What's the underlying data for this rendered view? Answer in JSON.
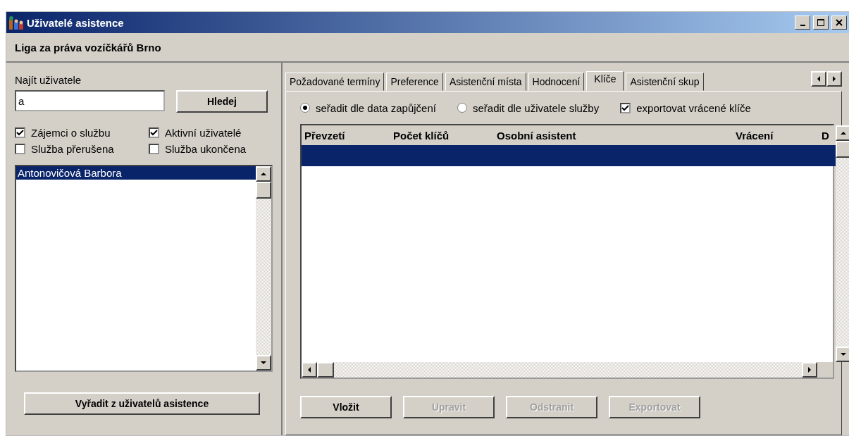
{
  "window": {
    "title": "Uživatelé asistence"
  },
  "organization": "Liga za práva vozíčkářů Brno",
  "search": {
    "label": "Najít uživatele",
    "value": "a",
    "button": "Hledej"
  },
  "filters": [
    {
      "label": "Zájemci o službu",
      "checked": true
    },
    {
      "label": "Aktivní uživatelé",
      "checked": true
    },
    {
      "label": "Služba přerušena",
      "checked": false
    },
    {
      "label": "Služba ukončena",
      "checked": false
    }
  ],
  "users": [
    {
      "name": "Antonovičová Barbora",
      "selected": true
    }
  ],
  "remove_button": "Vyřadit z uživatelů asistence",
  "tabs": [
    {
      "label": "Požadované termíny",
      "selected": false
    },
    {
      "label": "Preference",
      "selected": false
    },
    {
      "label": "Asistenční místa",
      "selected": false
    },
    {
      "label": "Hodnocení",
      "selected": false
    },
    {
      "label": "Klíče",
      "selected": true
    },
    {
      "label": "Asistenční skup",
      "selected": false
    }
  ],
  "sort_options": [
    {
      "label": "seřadit dle data zapůjčení",
      "selected": true
    },
    {
      "label": "seřadit dle uživatele služby",
      "selected": false
    }
  ],
  "export_returned": {
    "label": "exportovat vrácené klíče",
    "checked": true
  },
  "table": {
    "columns": [
      "Převzetí",
      "Počet klíčů",
      "Osobní asistent",
      "Vrácení",
      "D"
    ],
    "rows": [
      {
        "selected": true
      }
    ]
  },
  "buttons": [
    {
      "label": "Vložit",
      "disabled": false
    },
    {
      "label": "Upravit",
      "disabled": true
    },
    {
      "label": "Odstranit",
      "disabled": true
    },
    {
      "label": "Exportovat",
      "disabled": true
    }
  ]
}
